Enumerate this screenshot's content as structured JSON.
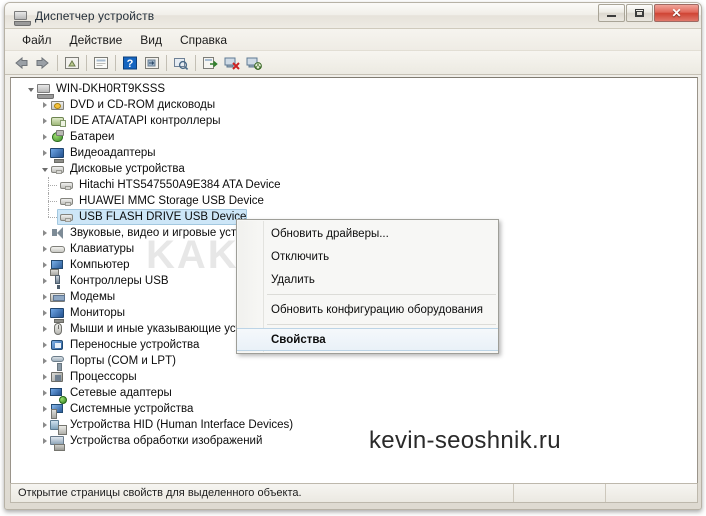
{
  "window": {
    "title": "Диспетчер устройств",
    "icon": "device-manager-icon",
    "controls": {
      "minimize_label": "–",
      "maximize_label": "□",
      "close_label": "✕"
    }
  },
  "menubar": {
    "items": [
      {
        "label": "Файл"
      },
      {
        "label": "Действие"
      },
      {
        "label": "Вид"
      },
      {
        "label": "Справка"
      }
    ]
  },
  "toolbar": {
    "buttons": [
      {
        "icon": "back-arrow-icon",
        "title": "Назад"
      },
      {
        "icon": "forward-arrow-icon",
        "title": "Вперед"
      },
      {
        "icon": "up-folder-icon",
        "title": "Вверх"
      },
      {
        "icon": "properties-page-icon",
        "title": "Свойства"
      },
      {
        "icon": "help-question-icon",
        "title": "Справка"
      },
      {
        "icon": "show-hidden-icon",
        "title": "Показать"
      },
      {
        "icon": "scan-hardware-icon",
        "title": "Обновить конфигурацию оборудования"
      },
      {
        "icon": "update-driver-icon",
        "title": "Обновить драйверы"
      },
      {
        "icon": "uninstall-device-icon",
        "title": "Удалить"
      },
      {
        "icon": "disable-device-icon",
        "title": "Отключить"
      }
    ]
  },
  "tree": {
    "root": {
      "label": "WIN-DKH0RT9KSSS",
      "icon": "computer-icon",
      "expanded": true
    },
    "nodes": [
      {
        "label": "DVD и CD-ROM дисководы",
        "icon": "dvd-drive-icon",
        "level": 1,
        "expanded": false
      },
      {
        "label": "IDE ATA/ATAPI контроллеры",
        "icon": "ide-controller-icon",
        "level": 1,
        "expanded": false
      },
      {
        "label": "Батареи",
        "icon": "battery-icon",
        "level": 1,
        "expanded": false
      },
      {
        "label": "Видеоадаптеры",
        "icon": "display-adapter-icon",
        "level": 1,
        "expanded": false
      },
      {
        "label": "Дисковые устройства",
        "icon": "disk-drive-icon",
        "level": 1,
        "expanded": true
      },
      {
        "label": "Hitachi HTS547550A9E384 ATA Device",
        "icon": "disk-icon",
        "level": 2,
        "leaf": true
      },
      {
        "label": "HUAWEI MMC Storage USB Device",
        "icon": "disk-icon",
        "level": 2,
        "leaf": true
      },
      {
        "label": "USB FLASH DRIVE USB Device",
        "icon": "disk-icon",
        "level": 2,
        "leaf": true,
        "selected": true
      },
      {
        "label": "Звуковые, видео и игровые устройства",
        "icon": "sound-device-icon",
        "level": 1,
        "expanded": false
      },
      {
        "label": "Клавиатуры",
        "icon": "keyboard-icon",
        "level": 1,
        "expanded": false
      },
      {
        "label": "Компьютер",
        "icon": "computer-node-icon",
        "level": 1,
        "expanded": false
      },
      {
        "label": "Контроллеры USB",
        "icon": "usb-controller-icon",
        "level": 1,
        "expanded": false
      },
      {
        "label": "Модемы",
        "icon": "modem-icon",
        "level": 1,
        "expanded": false
      },
      {
        "label": "Мониторы",
        "icon": "monitor-icon",
        "level": 1,
        "expanded": false
      },
      {
        "label": "Мыши и иные указывающие устройства",
        "icon": "mouse-icon",
        "level": 1,
        "expanded": false
      },
      {
        "label": "Переносные устройства",
        "icon": "portable-device-icon",
        "level": 1,
        "expanded": false
      },
      {
        "label": "Порты (COM и LPT)",
        "icon": "port-icon",
        "level": 1,
        "expanded": false
      },
      {
        "label": "Процессоры",
        "icon": "processor-icon",
        "level": 1,
        "expanded": false
      },
      {
        "label": "Сетевые адаптеры",
        "icon": "network-adapter-icon",
        "level": 1,
        "expanded": false
      },
      {
        "label": "Системные устройства",
        "icon": "system-device-icon",
        "level": 1,
        "expanded": false
      },
      {
        "label": "Устройства HID (Human Interface Devices)",
        "icon": "hid-device-icon",
        "level": 1,
        "expanded": false
      },
      {
        "label": "Устройства обработки изображений",
        "icon": "imaging-device-icon",
        "level": 1,
        "expanded": false
      }
    ]
  },
  "context_menu": {
    "items": [
      {
        "label": "Обновить драйверы...",
        "bold": false,
        "highlighted": false
      },
      {
        "label": "Отключить",
        "bold": false,
        "highlighted": false
      },
      {
        "label": "Удалить",
        "bold": false,
        "highlighted": false
      },
      {
        "separator": true
      },
      {
        "label": "Обновить конфигурацию оборудования",
        "bold": false,
        "highlighted": false
      },
      {
        "separator": true
      },
      {
        "label": "Свойства",
        "bold": true,
        "highlighted": true
      }
    ]
  },
  "statusbar": {
    "text": "Открытие страницы свойств для выделенного объекта."
  },
  "watermarks": {
    "site": "KAKDELAT.ORG",
    "author": "kevin-seoshnik.ru"
  },
  "colors": {
    "selection": "#cde6f7",
    "close_button": "#cf4434",
    "title_text": "#25303b"
  }
}
